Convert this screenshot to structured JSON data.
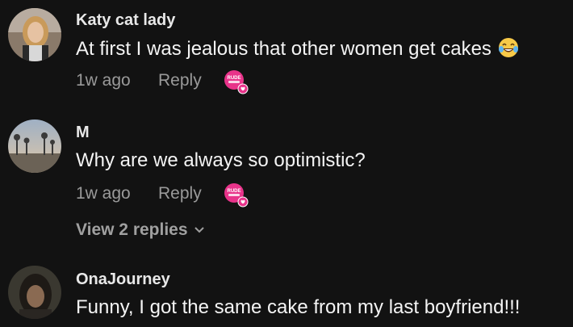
{
  "comments": [
    {
      "username": "Katy cat lady",
      "text": "At first I was jealous that other women get cakes",
      "emoji": "laughing-tears-emoji",
      "time": "1w ago",
      "reply_label": "Reply",
      "sticker_text": "RUDE"
    },
    {
      "username": "M",
      "text": "Why are we always so optimistic?",
      "time": "1w ago",
      "reply_label": "Reply",
      "sticker_text": "RUDE",
      "view_replies_label": "View 2 replies"
    },
    {
      "username": "OnaJourney",
      "text": "Funny, I got the same cake from my last boyfriend!!!"
    }
  ],
  "colors": {
    "background": "#121212",
    "meta_text": "#9a9a9a",
    "sticker_pink": "#e8338a"
  }
}
